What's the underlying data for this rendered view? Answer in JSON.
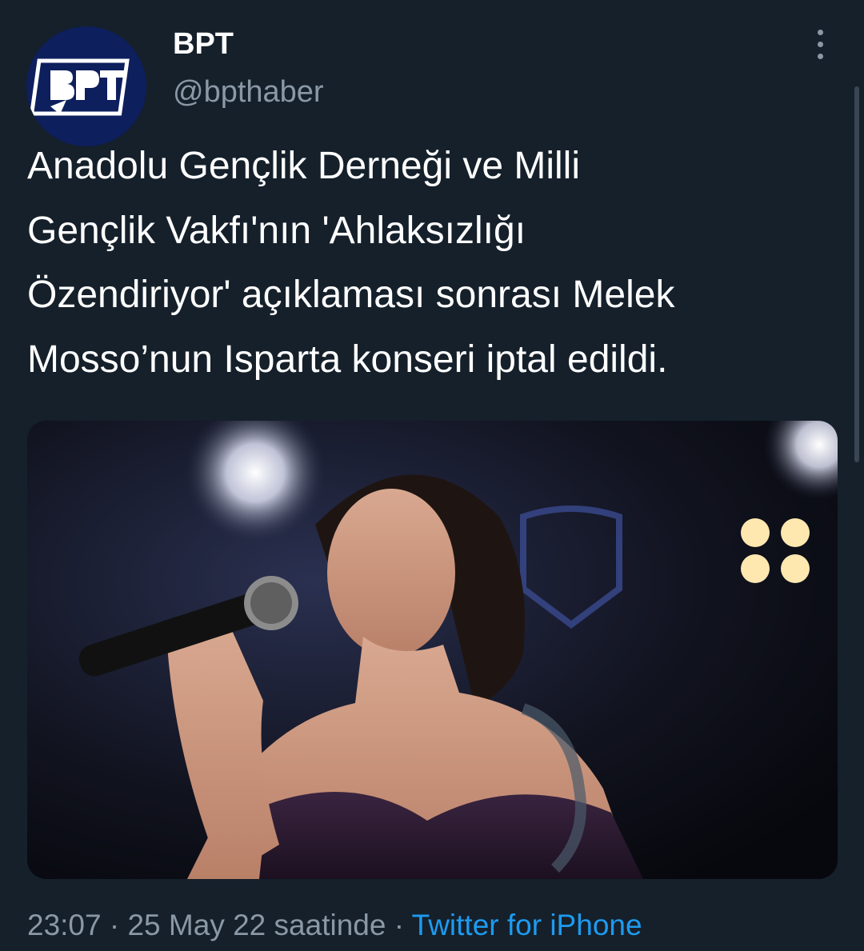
{
  "author": {
    "display_name": "BPT",
    "handle": "@bpthaber",
    "avatar_logo_text": "BPT"
  },
  "tweet": {
    "text_lines": [
      "Anadolu Gençlik Derneği ve Milli",
      "Gençlik Vakfı'nın 'Ahlaksızlığı",
      "Özendiriyor' açıklaması sonrası Melek",
      "Mosso’nun Isparta konseri iptal edildi."
    ]
  },
  "meta": {
    "time": "23:07",
    "separator": " · ",
    "date": "25 May 22 saatinde",
    "source": "Twitter for iPhone"
  },
  "colors": {
    "background": "#15202b",
    "text": "#ffffff",
    "muted": "#8b98a5",
    "accent": "#1d9bf0"
  },
  "icons": {
    "more": "more-vertical-icon"
  }
}
